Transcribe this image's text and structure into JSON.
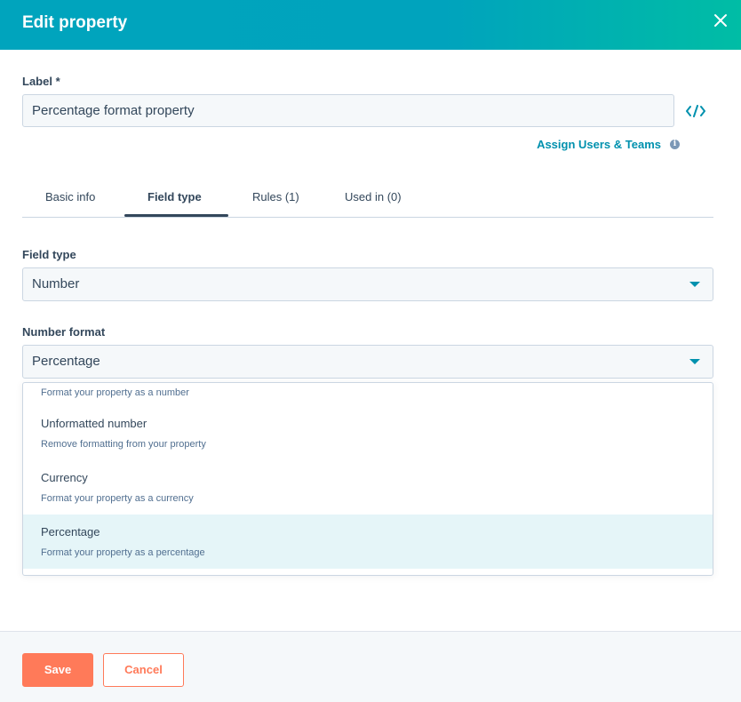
{
  "header": {
    "title": "Edit property"
  },
  "label_field": {
    "label": "Label *",
    "value": "Percentage format property"
  },
  "assign_link": "Assign Users & Teams",
  "tabs": [
    {
      "label": "Basic info",
      "active": false
    },
    {
      "label": "Field type",
      "active": true
    },
    {
      "label": "Rules (1)",
      "active": false
    },
    {
      "label": "Used in (0)",
      "active": false
    }
  ],
  "field_type": {
    "label": "Field type",
    "value": "Number"
  },
  "number_format": {
    "label": "Number format",
    "value": "Percentage",
    "options": [
      {
        "title": "",
        "desc": "Format your property as a number"
      },
      {
        "title": "Unformatted number",
        "desc": "Remove formatting from your property"
      },
      {
        "title": "Currency",
        "desc": "Format your property as a currency"
      },
      {
        "title": "Percentage",
        "desc": "Format your property as a percentage",
        "selected": true
      }
    ]
  },
  "footer": {
    "save_label": "Save",
    "cancel_label": "Cancel"
  },
  "colors": {
    "header": "#00a4bd",
    "accent": "#0091ae",
    "primary_button": "#ff7a59",
    "selected_option": "#e5f5f8",
    "text": "#33475b"
  },
  "icons": {
    "close": "close-icon",
    "code": "code-icon",
    "info": "info-icon",
    "caret": "caret-down-icon"
  }
}
